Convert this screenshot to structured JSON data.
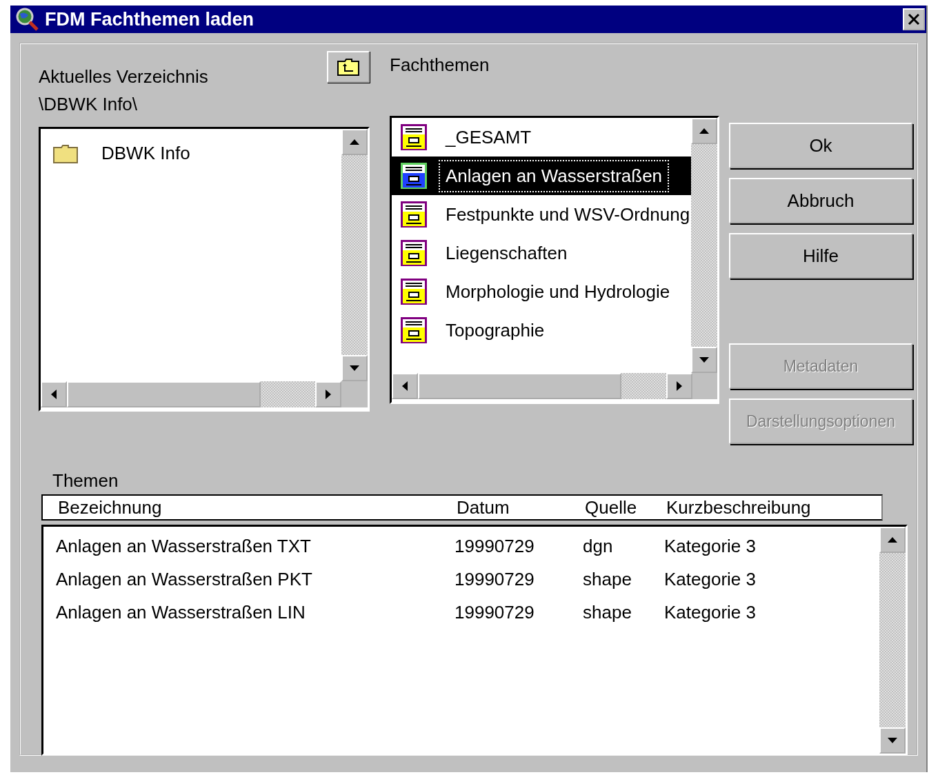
{
  "window": {
    "title": "FDM Fachthemen laden"
  },
  "directory": {
    "label": "Aktuelles Verzeichnis",
    "path": "\\DBWK Info\\",
    "items": [
      {
        "label": "DBWK Info"
      }
    ]
  },
  "fachthemen": {
    "label": "Fachthemen",
    "items": [
      {
        "label": "_GESAMT",
        "selected": false
      },
      {
        "label": "Anlagen an Wasserstraßen",
        "selected": true
      },
      {
        "label": "Festpunkte und WSV-Ordnung",
        "selected": false
      },
      {
        "label": "Liegenschaften",
        "selected": false
      },
      {
        "label": "Morphologie und Hydrologie",
        "selected": false
      },
      {
        "label": "Topographie",
        "selected": false
      }
    ]
  },
  "buttons": [
    {
      "label": "Ok",
      "disabled": false
    },
    {
      "label": "Abbruch",
      "disabled": false
    },
    {
      "label": "Hilfe",
      "disabled": false
    },
    {
      "label": "Metadaten",
      "disabled": true
    },
    {
      "label": "Darstellungsoptionen",
      "disabled": true
    }
  ],
  "themen": {
    "label": "Themen",
    "columns": [
      "Bezeichnung",
      "Datum",
      "Quelle",
      "Kurzbeschreibung"
    ],
    "rows": [
      [
        "Anlagen an Wasserstraßen TXT",
        "19990729",
        "dgn",
        "Kategorie 3"
      ],
      [
        "Anlagen an Wasserstraßen PKT",
        "19990729",
        "shape",
        "Kategorie 3"
      ],
      [
        "Anlagen an Wasserstraßen LIN",
        "19990729",
        "shape",
        "Kategorie 3"
      ]
    ]
  }
}
